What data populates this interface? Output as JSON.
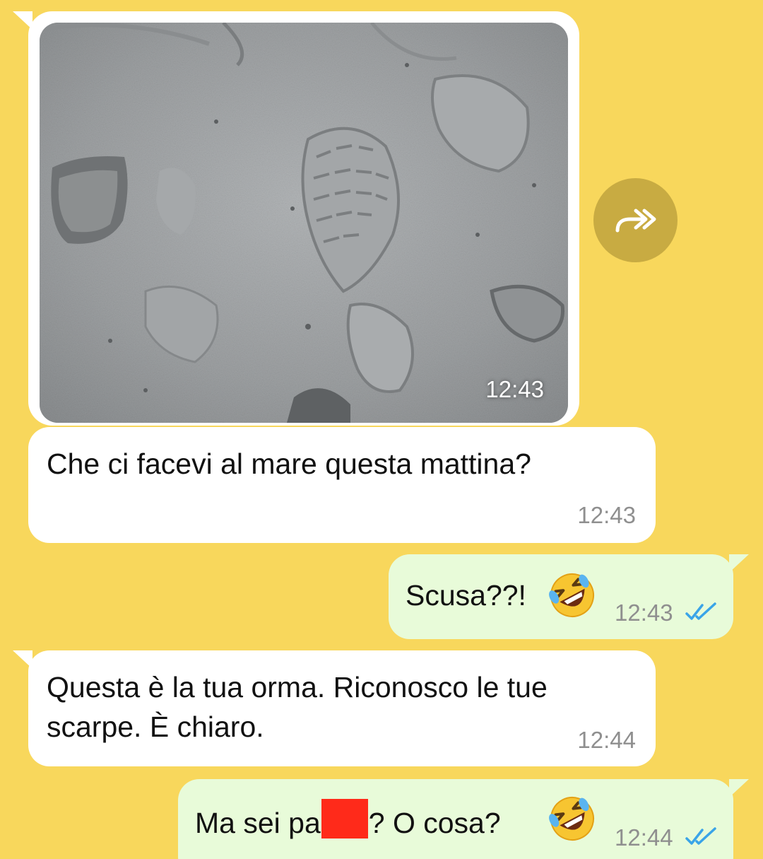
{
  "colors": {
    "chat_background": "#f8d75c",
    "incoming_bubble": "#ffffff",
    "outgoing_bubble": "#e8fbd9",
    "forward_button": "#c8ab42",
    "read_ticks": "#3aa4e8",
    "redaction": "#ff2a1a"
  },
  "messages": [
    {
      "direction": "incoming",
      "type": "image",
      "image_description_icon": "photo-sand-footprints",
      "time": "12:43"
    },
    {
      "direction": "incoming",
      "type": "text",
      "text": "Che ci facevi al mare questa mattina?",
      "time": "12:43"
    },
    {
      "direction": "outgoing",
      "type": "text",
      "text": "Scusa??!",
      "emoji": "rolling-on-floor-laughing-emoji",
      "time": "12:43",
      "status_icon": "double-check-read-icon"
    },
    {
      "direction": "incoming",
      "type": "text",
      "text_line1": "Questa è la tua orma. Riconosco le tue",
      "text_line2": "scarpe. È chiaro.",
      "time": "12:44"
    },
    {
      "direction": "outgoing",
      "type": "text",
      "text_before_redaction": "Ma sei pa",
      "text_after_redaction": "? O cosa?",
      "emoji": "rolling-on-floor-laughing-emoji",
      "time": "12:44",
      "status_icon": "double-check-read-icon"
    }
  ],
  "forward_button_icon": "forward-arrow-icon"
}
